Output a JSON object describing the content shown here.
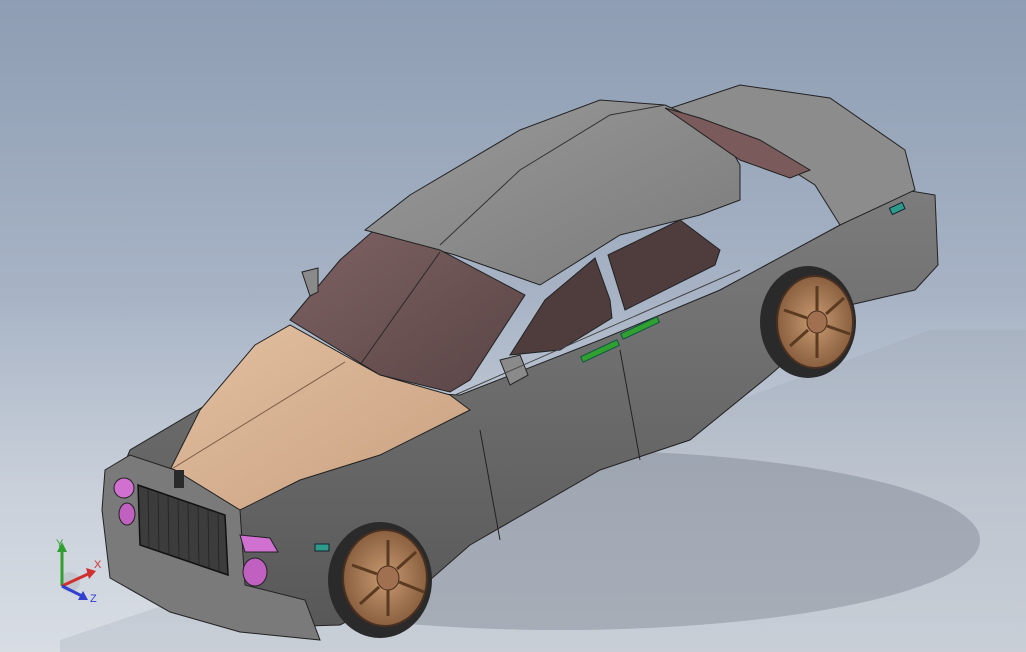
{
  "viewport": {
    "background_top": "#8e9db3",
    "background_bottom": "#d8dde4"
  },
  "model": {
    "body_color": "#6e6e6e",
    "roof_color": "#8a8a8a",
    "hood_color": "#d8b395",
    "glass_color": "#6e5556",
    "wheel_color": "#b9875e",
    "headlight_color": "#d070d0",
    "marker_color": "#2e9a8a",
    "handle_color": "#30a030"
  },
  "triad": {
    "x_label": "X",
    "y_label": "Y",
    "z_label": "Z",
    "x_color": "#d03030",
    "y_color": "#30a030",
    "z_color": "#3040d0"
  }
}
